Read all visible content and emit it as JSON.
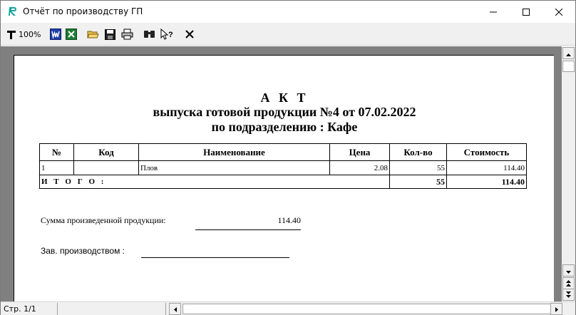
{
  "window": {
    "title": "Отчёт по производству ГП",
    "minimize_icon": "minimize-icon",
    "maximize_icon": "maximize-icon",
    "close_icon": "close-icon"
  },
  "toolbar": {
    "zoom_label": "100%",
    "items": [
      "zoom-icon",
      "word-icon",
      "excel-icon",
      "open-folder-icon",
      "save-icon",
      "print-icon",
      "find-icon",
      "help-pointer-icon",
      "close-preview-icon"
    ]
  },
  "report": {
    "title_line1": "А К Т",
    "title_line2": "выпуска готовой продукции №4 от 07.02.2022",
    "title_line3": "по подразделению : Кафе",
    "columns": [
      "№",
      "Код",
      "Наименование",
      "Цена",
      "Кол-во",
      "Стоимость"
    ],
    "rows": [
      {
        "no": "1",
        "code": "",
        "name": "Плов",
        "price": "2.08",
        "qty": "55",
        "cost": "114.40"
      }
    ],
    "total": {
      "label": "И Т О Г О :",
      "qty": "55",
      "cost": "114.40"
    },
    "sum_label": "Сумма произведенной продукции:",
    "sum_value": "114.40",
    "head_label": "Зав. производством :"
  },
  "status": {
    "page": "Стр. 1/1"
  },
  "colors": {
    "preview_bg": "#808080",
    "toolbar_bg": "#f0f0f0",
    "accent_word": "#1f3fa8",
    "accent_excel": "#1e7b34"
  }
}
